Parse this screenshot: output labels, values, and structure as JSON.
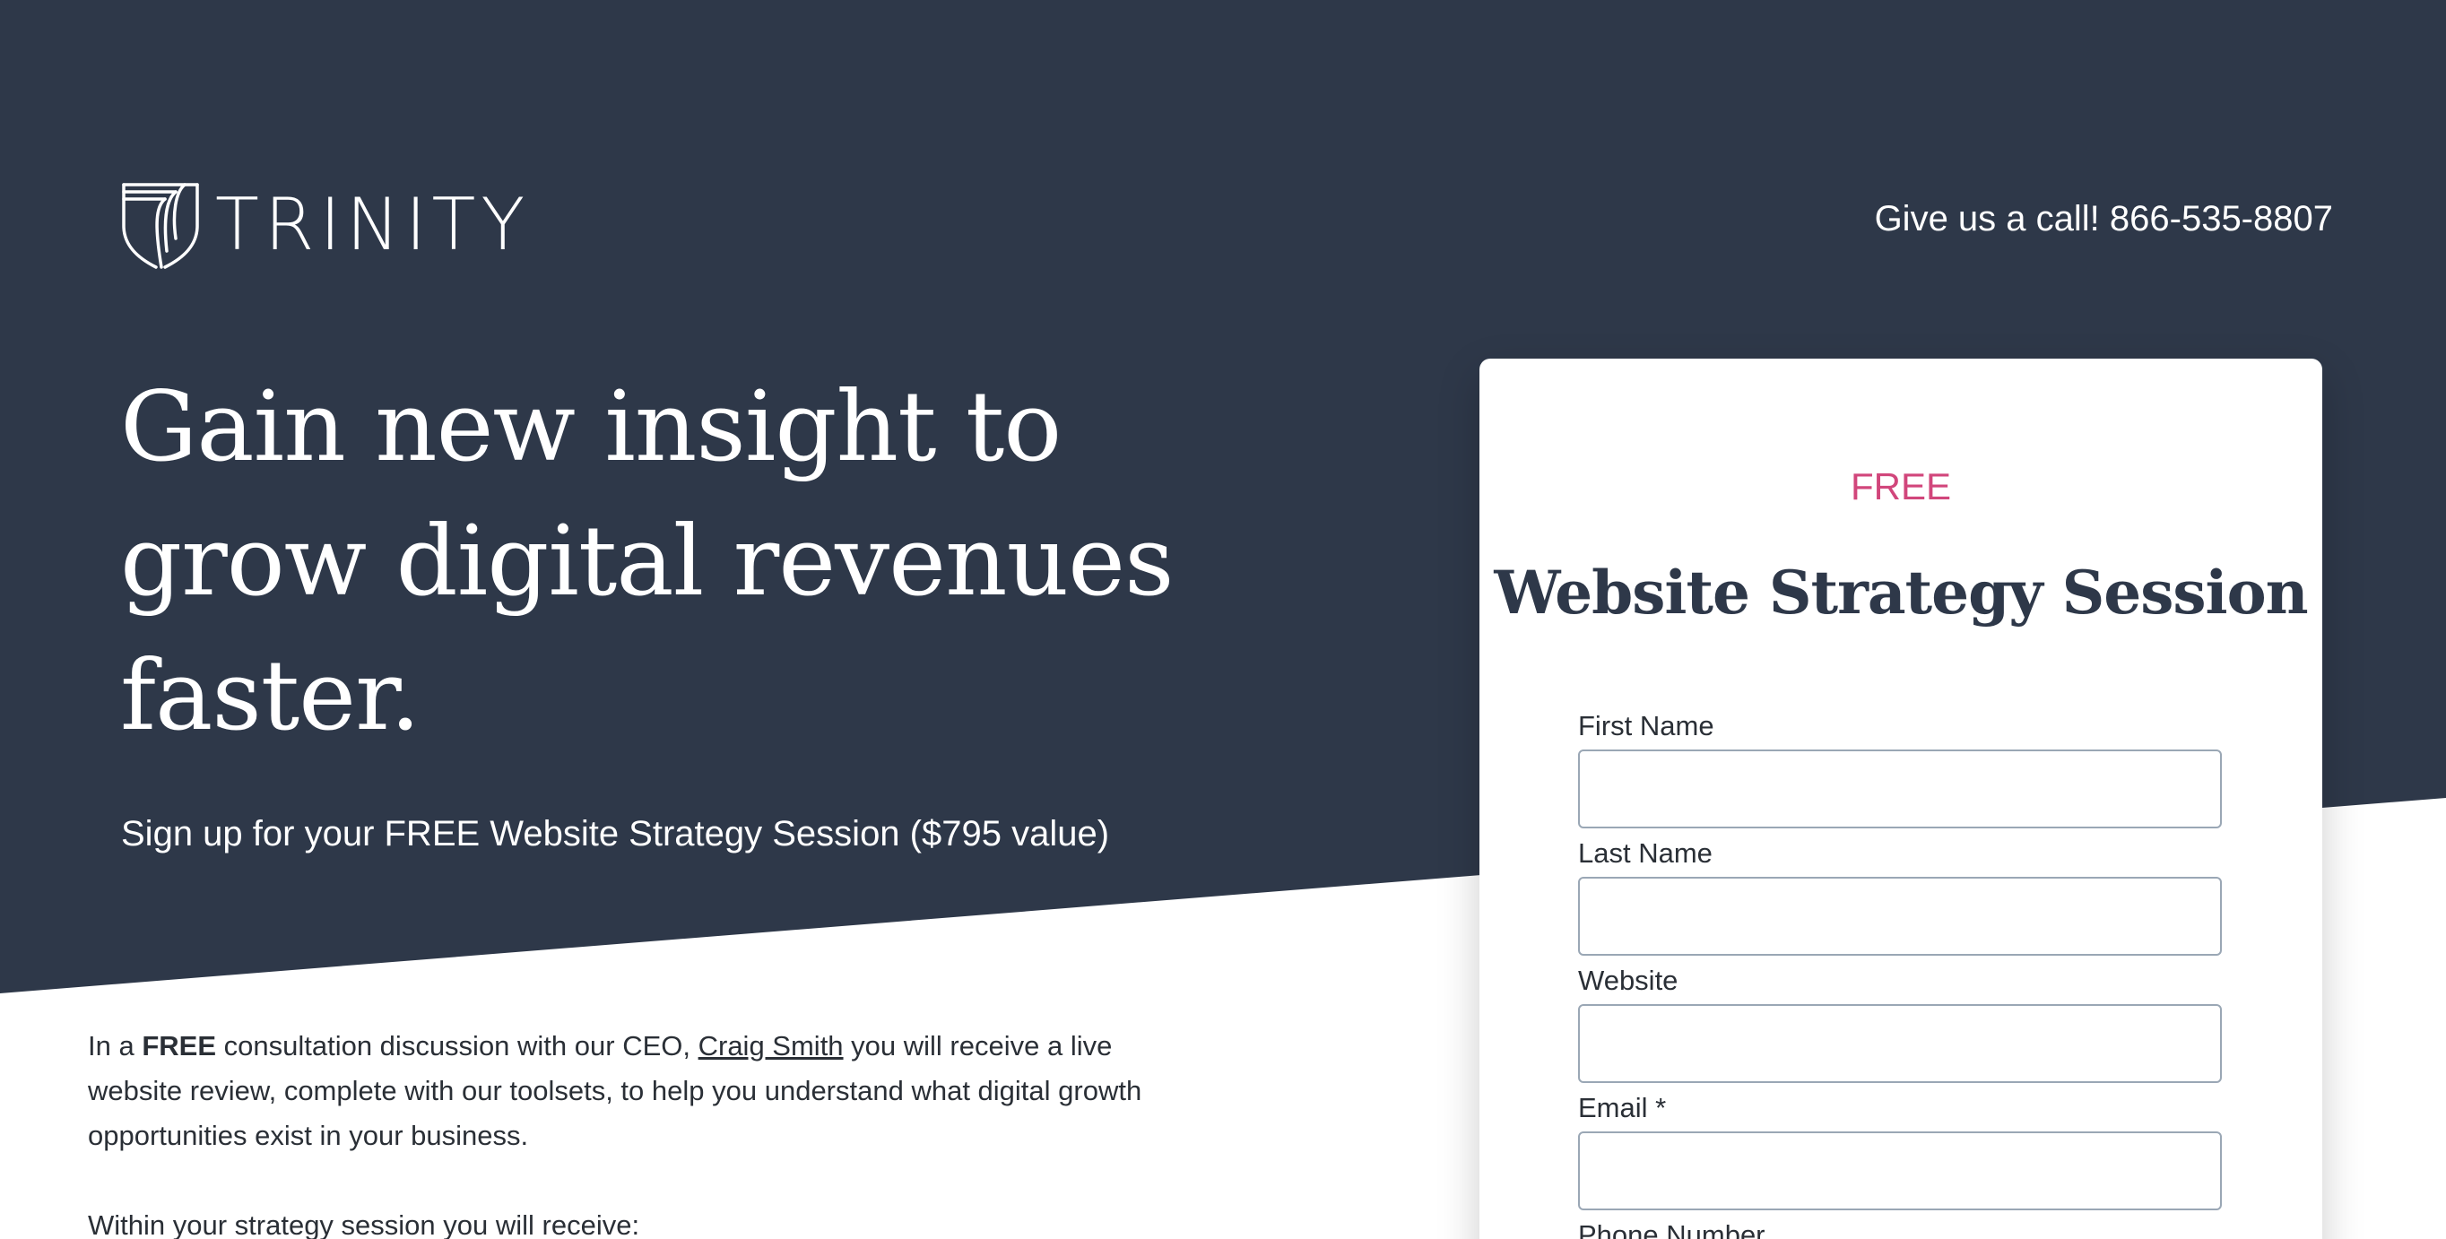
{
  "header": {
    "logo_text": "TRINITY",
    "phone_text": "Give us a call! 866-535-8807"
  },
  "hero": {
    "headline": "Gain new insight to grow digital revenues faster.",
    "subhead": "Sign up for your FREE Website Strategy Session ($795 value)"
  },
  "body": {
    "para1_prefix": "In a ",
    "para1_bold": "FREE",
    "para1_mid": " consultation discussion with our CEO, ",
    "para1_link": "Craig Smith",
    "para1_suffix": " you will receive a live website review, complete with our toolsets, to help you understand what digital growth opportunities exist in your business.",
    "para2": "Within your strategy session you will receive:"
  },
  "form": {
    "eyebrow": "FREE",
    "title": "Website Strategy Session",
    "fields": [
      {
        "label": "First Name",
        "value": ""
      },
      {
        "label": "Last Name",
        "value": ""
      },
      {
        "label": "Website",
        "value": ""
      },
      {
        "label": "Email *",
        "value": ""
      },
      {
        "label": "Phone Number",
        "value": ""
      }
    ]
  },
  "colors": {
    "hero_bg": "#2e3849",
    "accent": "#d1467b",
    "text_dark": "#2a2f36"
  }
}
